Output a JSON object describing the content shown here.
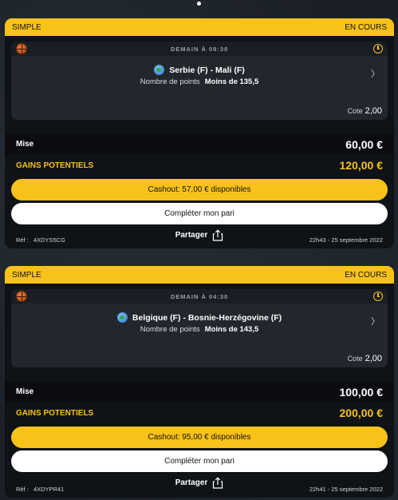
{
  "bets": [
    {
      "type": "SIMPLE",
      "status": "EN COURS",
      "event_time": "DEMAIN À 08:30",
      "sport_icon": "basketball-icon",
      "match": "Serbie (F) - Mali (F)",
      "market_label": "Nombre de points",
      "selection": "Moins de 135,5",
      "odds_label": "Cote",
      "odds": "2,00",
      "stake_label": "Mise",
      "stake": "60,00 €",
      "gains_label": "GAINS POTENTIELS",
      "gains": "120,00 €",
      "cashout_label": "Cashout: 57,00 € disponibles",
      "complete_label": "Compléter mon pari",
      "share_label": "Partager",
      "ref_label": "Réf :",
      "ref": "4XDYS5CG",
      "timestamp": "22h43 - 25 septembre 2022"
    },
    {
      "type": "SIMPLE",
      "status": "EN COURS",
      "event_time": "DEMAIN À 04:30",
      "sport_icon": "basketball-icon",
      "match": "Belgique (F) - Bosnie-Herzégovine (F)",
      "market_label": "Nombre de points",
      "selection": "Moins de 143,5",
      "odds_label": "Cote",
      "odds": "2,00",
      "stake_label": "Mise",
      "stake": "100,00 €",
      "gains_label": "GAINS POTENTIELS",
      "gains": "200,00 €",
      "cashout_label": "Cashout: 95,00 € disponibles",
      "complete_label": "Compléter mon pari",
      "share_label": "Partager",
      "ref_label": "Réf :",
      "ref": "4XDYPR41",
      "timestamp": "22h41 - 25 septembre 2022"
    }
  ],
  "colors": {
    "accent": "#f8c21a",
    "card_bg": "#0f1216",
    "event_bg": "#22272e"
  }
}
